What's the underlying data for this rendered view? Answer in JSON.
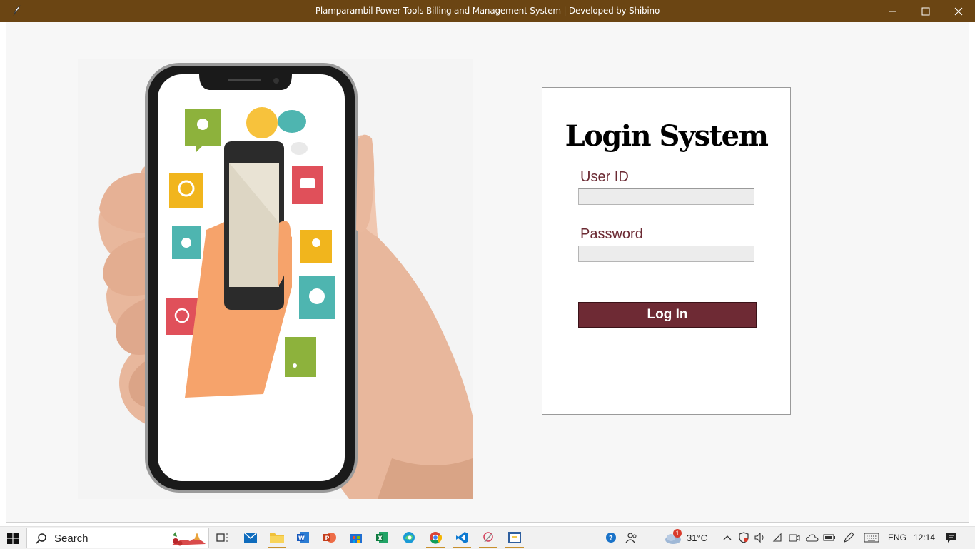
{
  "window": {
    "title": "Plamparambil Power Tools Billing and Management System |  Developed by Shibino"
  },
  "login": {
    "heading": "Login System",
    "user_id_label": "User ID",
    "user_id_value": "",
    "password_label": "Password",
    "password_value": "",
    "button_label": "Log In"
  },
  "taskbar": {
    "search_placeholder": "Search",
    "weather": {
      "temperature": "31°C",
      "badge": "1"
    },
    "language": "ENG",
    "time": "12:14",
    "pinned": [
      "task-view-icon",
      "mail-icon",
      "file-explorer-icon",
      "word-icon",
      "powerpoint-icon",
      "store-icon",
      "excel-icon",
      "edge-icon",
      "chrome-icon",
      "vscode-icon",
      "snipping-tool-icon",
      "python-app-icon"
    ]
  },
  "colors": {
    "titlebar": "#6b4513",
    "accent_maroon": "#6e2a34",
    "label_maroon": "#6b2a33"
  }
}
